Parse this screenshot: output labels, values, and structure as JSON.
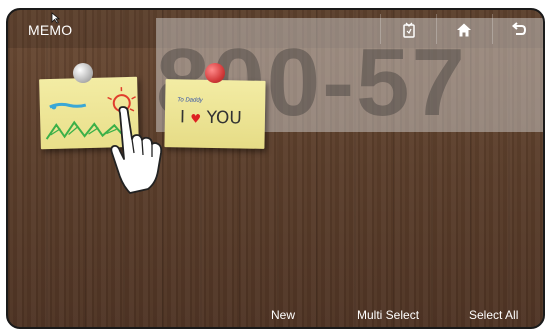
{
  "app": {
    "title": "MEMO"
  },
  "overlay": {
    "number_text": "800-57"
  },
  "toolbar": {
    "icons": [
      "memo-icon",
      "home-icon",
      "back-icon"
    ]
  },
  "memos": [
    {
      "type": "drawing"
    },
    {
      "small_text": "To Daddy",
      "text_before": "I",
      "heart": "♥",
      "text_after": "YOU"
    }
  ],
  "bottom": {
    "new_label": "New",
    "multi_select_label": "Multi Select",
    "select_all_label": "Select All"
  }
}
